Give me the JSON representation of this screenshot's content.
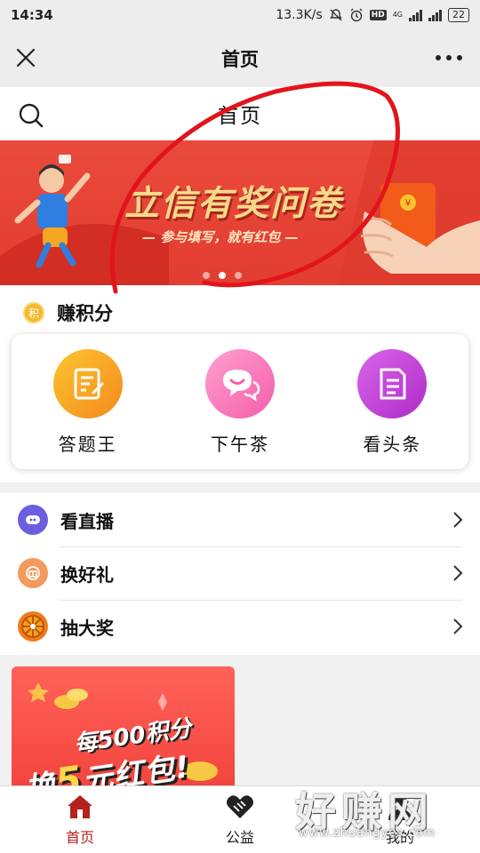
{
  "status_bar": {
    "time": "14:34",
    "net_speed": "13.3K/s",
    "network": "4G",
    "hd": "HD",
    "battery": "22"
  },
  "nav": {
    "title": "首页"
  },
  "page_header": {
    "title": "首页"
  },
  "banner": {
    "title": "立信有奖问卷",
    "subtitle": "— 参与填写，就有红包 —",
    "envelope_char": "¥",
    "slides": 3,
    "active_slide": 1,
    "colors": {
      "bg": "#e23d31",
      "title": "#f7d98a"
    }
  },
  "earn": {
    "badge": "积",
    "title": "赚积分",
    "items": [
      {
        "label": "答题王",
        "icon": "answer-icon"
      },
      {
        "label": "下午茶",
        "icon": "chat-icon"
      },
      {
        "label": "看头条",
        "icon": "news-icon"
      }
    ]
  },
  "list": {
    "items": [
      {
        "label": "看直播",
        "icon": "live-icon",
        "color": "#6b5ee0"
      },
      {
        "label": "换好礼",
        "icon": "gift-icon",
        "color": "#f39a5c"
      },
      {
        "label": "抽大奖",
        "icon": "wheel-icon",
        "color": "#f07c1a"
      }
    ]
  },
  "promo": {
    "line1": "每500积分",
    "line2_pre": "换",
    "line2_num": "5",
    "line2_post": "元红包!"
  },
  "tabbar": {
    "tabs": [
      {
        "label": "首页",
        "active": true
      },
      {
        "label": "公益",
        "active": false
      },
      {
        "label": "我的",
        "active": false
      }
    ]
  },
  "watermark": {
    "text": "好赚网",
    "url": "www.zhuangyes.com"
  }
}
